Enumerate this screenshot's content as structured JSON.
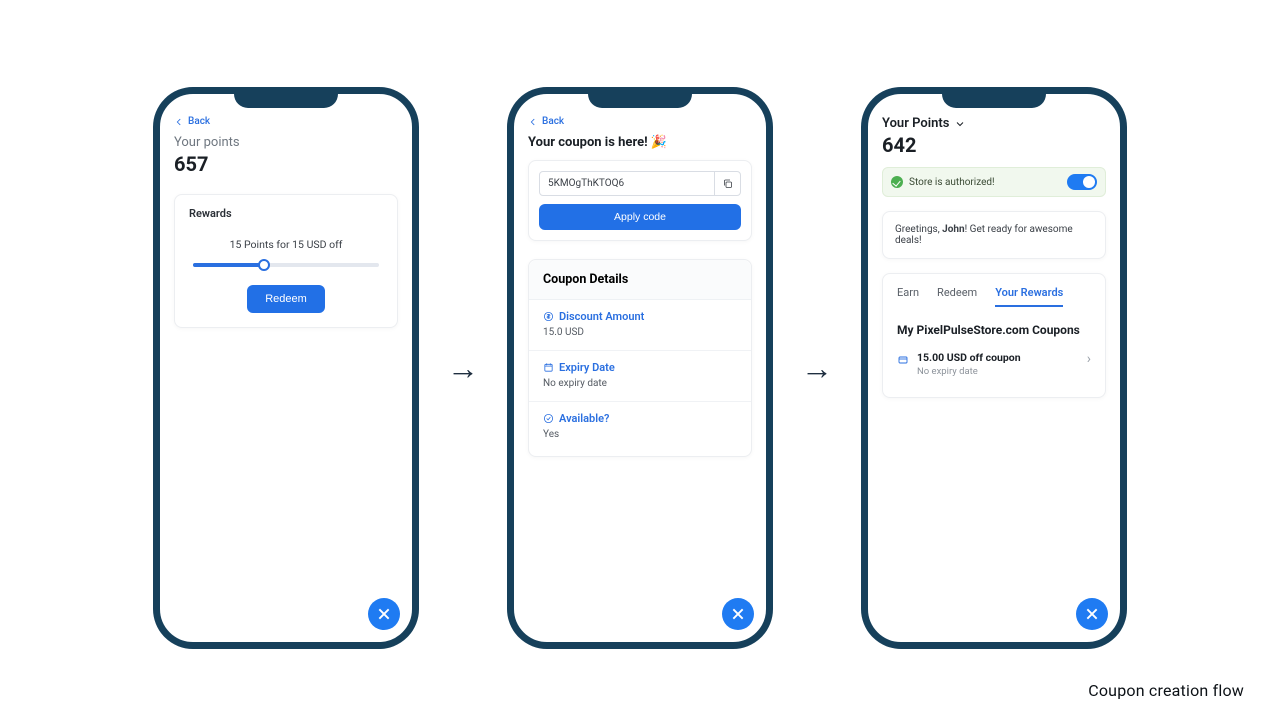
{
  "caption": "Coupon creation flow",
  "arrows": {
    "glyph": "→"
  },
  "common": {
    "back_label": "Back",
    "close_label": "Close"
  },
  "screen1": {
    "points_label": "Your points",
    "points_value": "657",
    "rewards_title": "Rewards",
    "offer_text": "15 Points for 15 USD off",
    "slider_percent": 38,
    "redeem_label": "Redeem"
  },
  "screen2": {
    "title": "Your coupon is here! 🎉",
    "code_value": "5KMOgThKTOQ6",
    "apply_label": "Apply code",
    "details_header": "Coupon Details",
    "amount_label": "Discount Amount",
    "amount_value": "15.0 USD",
    "expiry_label": "Expiry Date",
    "expiry_value": "No expiry date",
    "available_label": "Available?",
    "available_value": "Yes"
  },
  "screen3": {
    "points_label": "Your Points",
    "points_value": "642",
    "auth_text": "Store is authorized!",
    "greeting_pre": "Greetings, ",
    "greeting_user": "John",
    "greeting_post": "! Get ready for awesome deals!",
    "tabs": {
      "earn": "Earn",
      "redeem": "Redeem",
      "your_rewards": "Your Rewards"
    },
    "coupons_heading": "My PixelPulseStore.com Coupons",
    "coupon_item_title": "15.00 USD off coupon",
    "coupon_item_sub": "No expiry date"
  }
}
